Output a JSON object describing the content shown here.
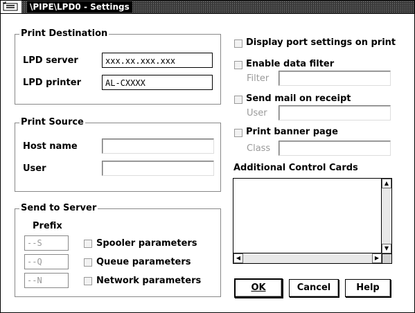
{
  "window": {
    "title": "\\PIPE\\LPD0 - Settings"
  },
  "print_destination": {
    "title": "Print Destination",
    "lpd_server_label": "LPD server",
    "lpd_server_value": "xxx.xx.xxx.xxx",
    "lpd_printer_label": "LPD printer",
    "lpd_printer_value": "AL-CXXXX"
  },
  "print_source": {
    "title": "Print Source",
    "host_name_label": "Host name",
    "host_name_value": "",
    "user_label": "User",
    "user_value": ""
  },
  "send_to_server": {
    "title": "Send to Server",
    "prefix_label": "Prefix",
    "spooler_prefix": "--S",
    "queue_prefix": "--Q",
    "network_prefix": "--N",
    "spooler_label": "Spooler parameters",
    "queue_label": "Queue parameters",
    "network_label": "Network parameters"
  },
  "options": {
    "display_port": "Display port settings on print",
    "enable_filter": "Enable data filter",
    "filter_label": "Filter",
    "filter_value": "",
    "send_mail": "Send mail on receipt",
    "user_label": "User",
    "user_value": "",
    "print_banner": "Print banner page",
    "class_label": "Class",
    "class_value": ""
  },
  "additional": {
    "label": "Additional Control Cards",
    "content": ""
  },
  "buttons": {
    "ok": "OK",
    "cancel": "Cancel",
    "help": "Help"
  },
  "colors": {
    "title_bg": "#3a3a3a",
    "border": "#000000",
    "disabled_text": "#999999"
  }
}
